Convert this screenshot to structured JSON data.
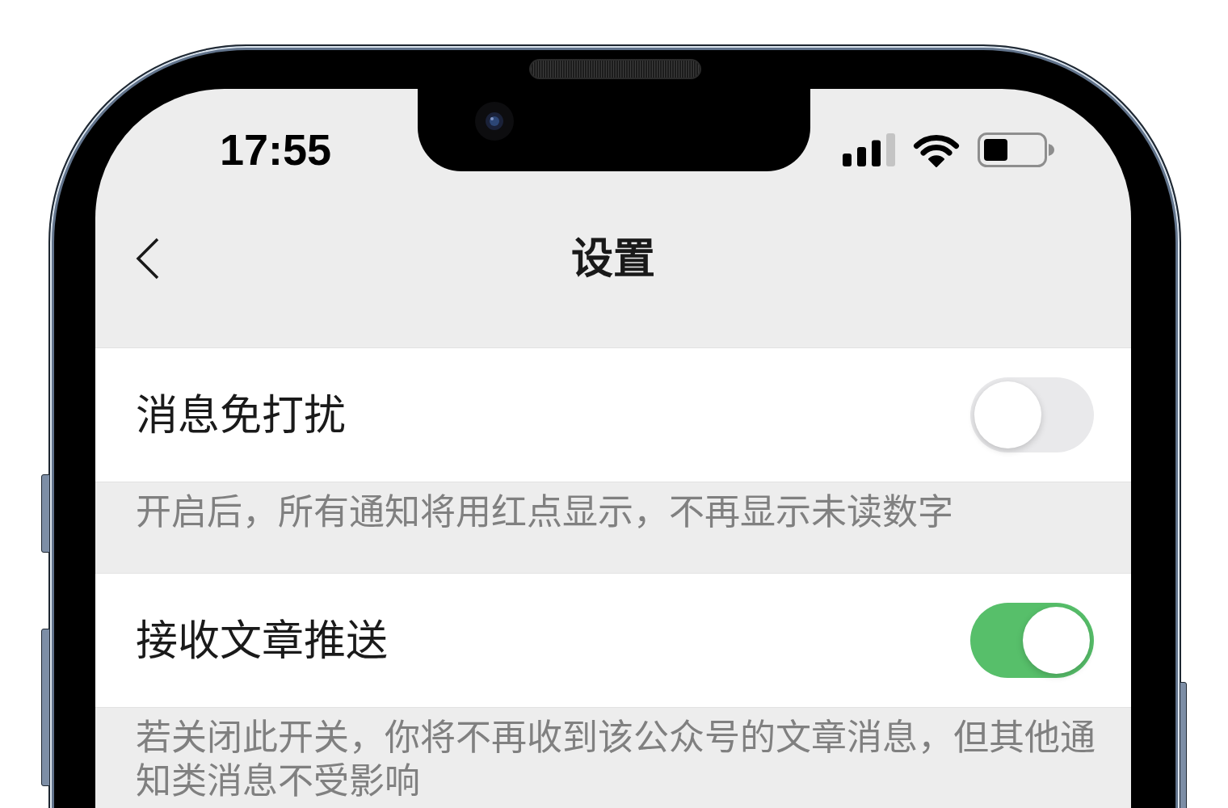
{
  "status_bar": {
    "time": "17:55"
  },
  "nav_bar": {
    "title": "设置"
  },
  "settings": [
    {
      "label": "消息免打扰",
      "on": false,
      "description": "开启后，所有通知将用红点显示，不再显示未读数字"
    },
    {
      "label": "接收文章推送",
      "on": true,
      "description": "若关闭此开关，你将不再收到该公众号的文章消息，但其他通知类消息不受影响"
    }
  ]
}
